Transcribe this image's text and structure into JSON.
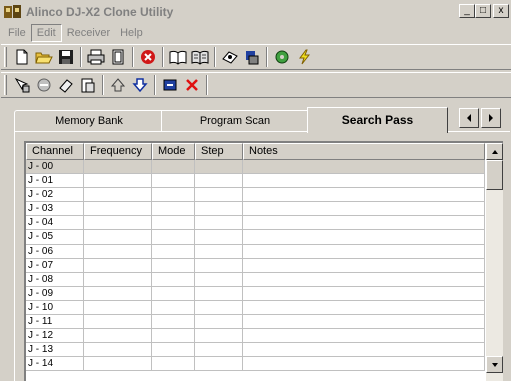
{
  "window": {
    "title": "Alinco DJ-X2 Clone Utility",
    "minimize_label": "_",
    "maximize_label": "□",
    "close_label": "x"
  },
  "menu": [
    {
      "label": "File"
    },
    {
      "label": "Edit"
    },
    {
      "label": "Receiver"
    },
    {
      "label": "Help"
    }
  ],
  "toolbar1": [
    "new-file-icon",
    "open-folder-icon",
    "save-disk-icon",
    "print-icon",
    "page-icon",
    "stop-icon",
    "read-book-icon",
    "write-book-icon",
    "radio-icon",
    "radio-transfer-icon",
    "settings-icon",
    "lightning-icon"
  ],
  "toolbar2": [
    "pointer-tool-icon",
    "erase-circle-icon",
    "eraser-icon",
    "paste-icon",
    "move-up-icon",
    "move-down-icon",
    "insert-icon",
    "delete-x-icon"
  ],
  "tabs": [
    {
      "label": "Memory Bank"
    },
    {
      "label": "Program Scan"
    },
    {
      "label": "Search Pass"
    }
  ],
  "grid": {
    "columns": [
      "Channel",
      "Frequency",
      "Mode",
      "Step",
      "Notes"
    ],
    "rows": [
      {
        "channel": "J - 00",
        "frequency": "",
        "mode": "",
        "step": "",
        "notes": ""
      },
      {
        "channel": "J - 01",
        "frequency": "",
        "mode": "",
        "step": "",
        "notes": ""
      },
      {
        "channel": "J - 02",
        "frequency": "",
        "mode": "",
        "step": "",
        "notes": ""
      },
      {
        "channel": "J - 03",
        "frequency": "",
        "mode": "",
        "step": "",
        "notes": ""
      },
      {
        "channel": "J - 04",
        "frequency": "",
        "mode": "",
        "step": "",
        "notes": ""
      },
      {
        "channel": "J - 05",
        "frequency": "",
        "mode": "",
        "step": "",
        "notes": ""
      },
      {
        "channel": "J - 06",
        "frequency": "",
        "mode": "",
        "step": "",
        "notes": ""
      },
      {
        "channel": "J - 07",
        "frequency": "",
        "mode": "",
        "step": "",
        "notes": ""
      },
      {
        "channel": "J - 08",
        "frequency": "",
        "mode": "",
        "step": "",
        "notes": ""
      },
      {
        "channel": "J - 09",
        "frequency": "",
        "mode": "",
        "step": "",
        "notes": ""
      },
      {
        "channel": "J - 10",
        "frequency": "",
        "mode": "",
        "step": "",
        "notes": ""
      },
      {
        "channel": "J - 11",
        "frequency": "",
        "mode": "",
        "step": "",
        "notes": ""
      },
      {
        "channel": "J - 12",
        "frequency": "",
        "mode": "",
        "step": "",
        "notes": ""
      },
      {
        "channel": "J - 13",
        "frequency": "",
        "mode": "",
        "step": "",
        "notes": ""
      },
      {
        "channel": "J - 14",
        "frequency": "",
        "mode": "",
        "step": "",
        "notes": ""
      }
    ]
  },
  "colors": {
    "face": "#d4d0c8",
    "disabled_text": "#808080",
    "stop_red": "#d01818",
    "delete_red": "#e01010",
    "arrow_blue": "#1030a0"
  }
}
